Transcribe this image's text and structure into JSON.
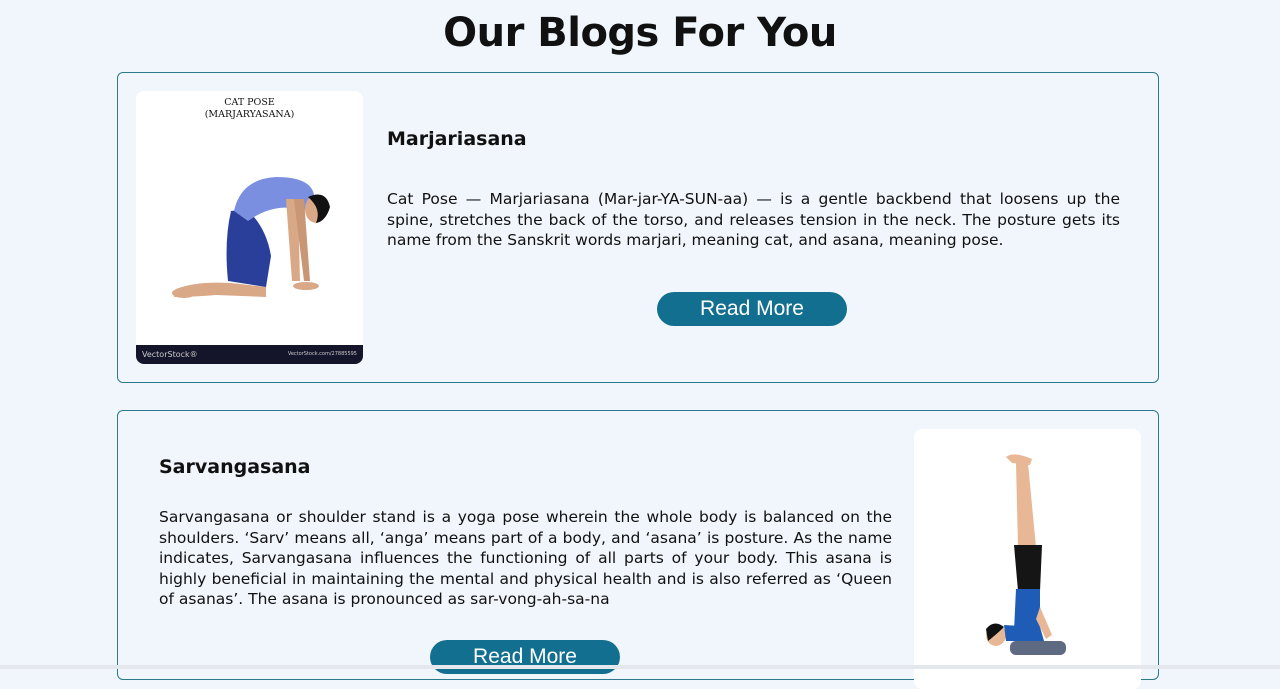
{
  "page": {
    "title": "Our Blogs For You"
  },
  "blogs": [
    {
      "title": "Marjariasana",
      "text": "Cat Pose — Marjariasana (Mar-jar-YA-SUN-aa) — is a gentle backbend that loosens up the spine, stretches the back of the torso, and releases tension in the neck. The posture gets its name from the Sanskrit words marjari, meaning cat, and asana, meaning pose.",
      "button": "Read More",
      "image": {
        "caption_line1": "CAT POSE",
        "caption_line2": "(MARJARYASANA)",
        "watermark_left": "VectorStock®",
        "watermark_right": "VectorStock.com/27885595"
      }
    },
    {
      "title": "Sarvangasana",
      "text": "Sarvangasana or shoulder stand is a yoga pose wherein the whole body is balanced on the shoulders. ‘Sarv’ means all, ‘anga’ means part of a body, and ‘asana’ is posture. As the name indicates, Sarvangasana influences the functioning of all parts of your body. This asana is highly beneficial in maintaining the mental and physical health and is also referred as ‘Queen of asanas’. The asana is pronounced as sar-vong-ah-sa-na",
      "button": "Read More"
    }
  ]
}
